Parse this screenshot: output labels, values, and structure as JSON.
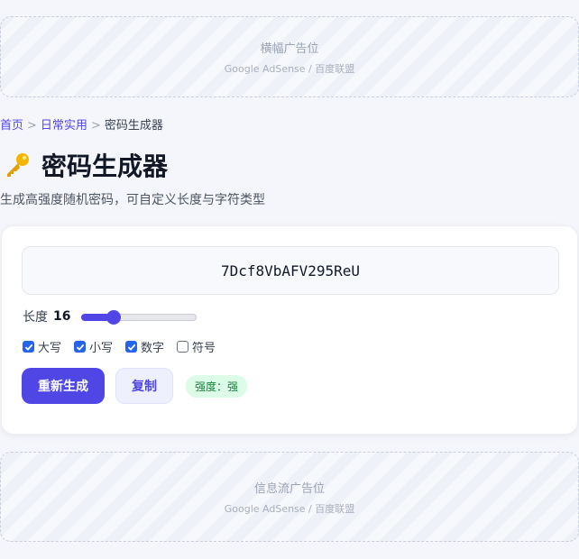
{
  "ad_top": {
    "title": "横幅广告位",
    "subtitle": "Google AdSense / 百度联盟"
  },
  "breadcrumb": {
    "home": "首页",
    "sep": ">",
    "category": "日常实用",
    "current": "密码生成器"
  },
  "page": {
    "icon": "key-icon",
    "title": "密码生成器",
    "subtitle": "生成高强度随机密码，可自定义长度与字符类型"
  },
  "generator": {
    "password": "7Dcf8VbAFV295ReU",
    "length_label": "长度",
    "length_value": "16",
    "length_fraction": 0.25,
    "options": [
      {
        "label": "大写",
        "checked": true
      },
      {
        "label": "小写",
        "checked": true
      },
      {
        "label": "数字",
        "checked": true
      },
      {
        "label": "符号",
        "checked": false
      }
    ],
    "regenerate_label": "重新生成",
    "copy_label": "复制",
    "strength_label": "强度：强"
  },
  "ad_bottom": {
    "title": "信息流广告位",
    "subtitle": "Google AdSense / 百度联盟"
  },
  "colors": {
    "accent": "#4f46e5",
    "checkbox": "#2563eb",
    "strength_bg": "#dcfce7",
    "strength_text": "#15803d"
  }
}
